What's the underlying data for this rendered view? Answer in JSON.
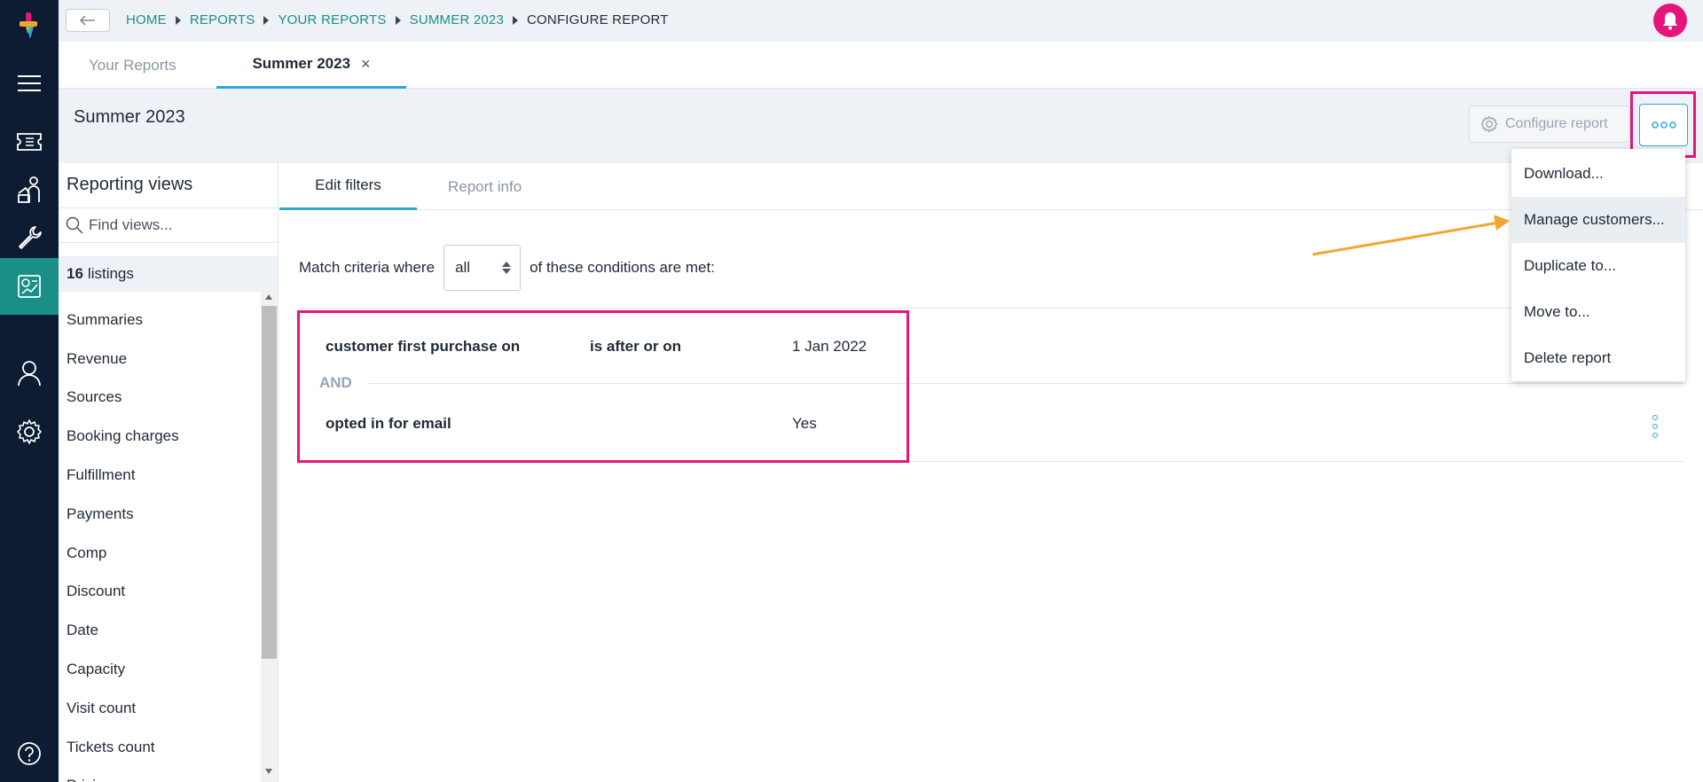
{
  "breadcrumb": {
    "items": [
      "HOME",
      "REPORTS",
      "YOUR REPORTS",
      "SUMMER 2023"
    ],
    "current": "CONFIGURE REPORT"
  },
  "tabs": {
    "your_reports": "Your Reports",
    "active": "Summer 2023"
  },
  "header": {
    "title": "Summer 2023",
    "configure_label": "Configure report"
  },
  "sidebar": {
    "title": "Reporting views",
    "search_placeholder": "Find views...",
    "count": "16",
    "count_label": "listings",
    "items": [
      "Summaries",
      "Revenue",
      "Sources",
      "Booking charges",
      "Fulfillment",
      "Payments",
      "Comp",
      "Discount",
      "Date",
      "Capacity",
      "Visit count",
      "Tickets count",
      "Pricing"
    ]
  },
  "main": {
    "tabs": [
      "Edit filters",
      "Report info"
    ],
    "match_prefix": "Match criteria where",
    "match_value": "all",
    "match_suffix": "of these conditions are met:",
    "conditions": [
      {
        "field": "customer first purchase on",
        "operator": "is after or on",
        "value": "1 Jan 2022"
      },
      {
        "field": "opted in for email",
        "operator": "",
        "value": "Yes"
      }
    ],
    "joiner": "AND"
  },
  "menu": {
    "items": [
      "Download...",
      "Manage customers...",
      "Duplicate to...",
      "Move to...",
      "Delete report"
    ],
    "highlighted": "Manage customers..."
  },
  "colors": {
    "rail": "#0d1b33",
    "teal": "#1a8f87",
    "accent_blue": "#2fa6d8",
    "highlight_pink": "#e6157a",
    "arrow_orange": "#f2a630"
  }
}
